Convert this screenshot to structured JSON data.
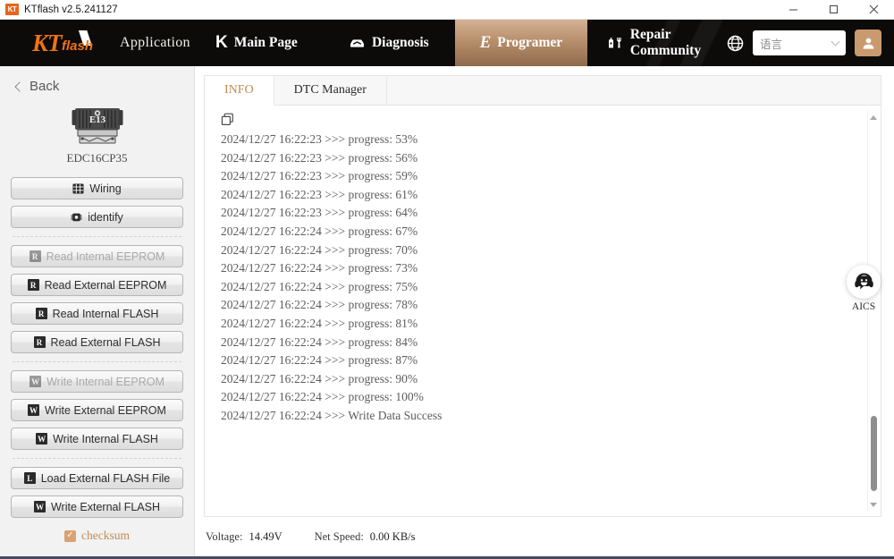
{
  "window": {
    "title": "KTflash v2.5.241127",
    "logo_text": "KT",
    "minimize_icon": "—",
    "maximize_icon": "☐",
    "close_icon": "✕"
  },
  "navbar": {
    "brand_kt": "KT",
    "brand_flash": "flash",
    "brand_app_label": "Application",
    "items": [
      {
        "label": "Main Page",
        "icon": "k-icon",
        "active": false
      },
      {
        "label": "Diagnosis",
        "icon": "car-icon",
        "active": false
      },
      {
        "label": "Programer",
        "icon": "e-icon",
        "active": true
      },
      {
        "label": "Repair Community",
        "icon": "tools-icon",
        "active": false
      }
    ],
    "language": {
      "value": "语言",
      "icon": "globe-icon"
    },
    "account_icon": "user-icon",
    "active_color": "#b78f6c"
  },
  "sidebar": {
    "back_label": "Back",
    "device": {
      "image_label": "E13",
      "name": "EDC16CP35"
    },
    "groups": [
      {
        "buttons": [
          {
            "label": "Wiring",
            "icon": "grid-icon",
            "disabled": false
          },
          {
            "label": "identify",
            "icon": "chip-icon",
            "disabled": false
          }
        ]
      },
      {
        "buttons": [
          {
            "label": "Read Internal EEPROM",
            "icon": "R",
            "disabled": true
          },
          {
            "label": "Read External EEPROM",
            "icon": "R",
            "disabled": false
          },
          {
            "label": "Read Internal FLASH",
            "icon": "R",
            "disabled": false
          },
          {
            "label": "Read External FLASH",
            "icon": "R",
            "disabled": false
          }
        ]
      },
      {
        "buttons": [
          {
            "label": "Write Internal EEPROM",
            "icon": "W",
            "disabled": true
          },
          {
            "label": "Write External EEPROM",
            "icon": "W",
            "disabled": false
          },
          {
            "label": "Write Internal FLASH",
            "icon": "W",
            "disabled": false
          }
        ]
      },
      {
        "buttons": [
          {
            "label": "Load External FLASH File",
            "icon": "L",
            "disabled": false
          },
          {
            "label": "Write External FLASH",
            "icon": "W",
            "disabled": false
          }
        ]
      }
    ],
    "checksum": {
      "label": "checksum",
      "checked": true,
      "check_glyph": "✓",
      "color": "#c08a57"
    }
  },
  "main": {
    "tabs": [
      {
        "label": "INFO",
        "active": true
      },
      {
        "label": "DTC Manager",
        "active": false
      }
    ],
    "copy_icon": "copy-icon",
    "log_lines": [
      "2024/12/27 16:22:23 >>> progress: 53%",
      "2024/12/27 16:22:23 >>> progress: 56%",
      "2024/12/27 16:22:23 >>> progress: 59%",
      "2024/12/27 16:22:23 >>> progress: 61%",
      "2024/12/27 16:22:23 >>> progress: 64%",
      "2024/12/27 16:22:24 >>> progress: 67%",
      "2024/12/27 16:22:24 >>> progress: 70%",
      "2024/12/27 16:22:24 >>> progress: 73%",
      "2024/12/27 16:22:24 >>> progress: 75%",
      "2024/12/27 16:22:24 >>> progress: 78%",
      "2024/12/27 16:22:24 >>> progress: 81%",
      "2024/12/27 16:22:24 >>> progress: 84%",
      "2024/12/27 16:22:24 >>> progress: 87%",
      "2024/12/27 16:22:24 >>> progress: 90%",
      "2024/12/27 16:22:24 >>> progress: 100%",
      "2024/12/27 16:22:24 >>> Write Data Success"
    ],
    "status": {
      "voltage_label": "Voltage:",
      "voltage_value": "14.49V",
      "netspeed_label": "Net Speed:",
      "netspeed_value": "0.00 KB/s"
    }
  },
  "floating": {
    "aics_label": "AICS",
    "aics_icon": "headset-support-icon"
  }
}
